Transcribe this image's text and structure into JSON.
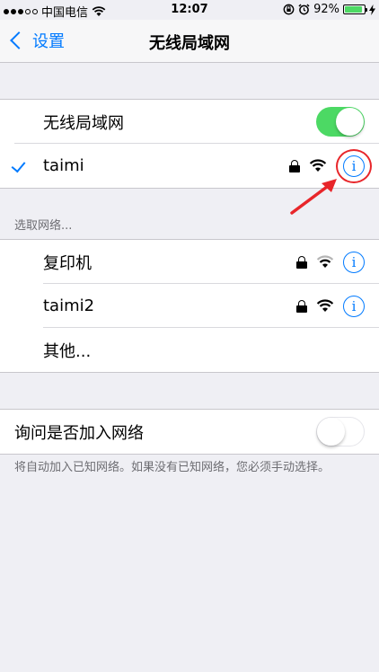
{
  "status_bar": {
    "signal_dots_filled": 3,
    "signal_dots_total": 5,
    "carrier": "中国电信",
    "time": "12:07",
    "battery_percent": "92%",
    "battery_level": 0.92,
    "icons": [
      "wifi-icon",
      "orientation-lock-icon",
      "alarm-icon",
      "charging-icon"
    ]
  },
  "nav": {
    "back_label": "设置",
    "title": "无线局域网"
  },
  "wifi_toggle": {
    "label": "无线局域网",
    "on": true
  },
  "connected_network": {
    "name": "taimi",
    "secured": true
  },
  "choose_network_header": "选取网络...",
  "networks": [
    {
      "name": "复印机",
      "secured": true
    },
    {
      "name": "taimi2",
      "secured": true
    }
  ],
  "other_label": "其他...",
  "ask_to_join": {
    "label": "询问是否加入网络",
    "on": false
  },
  "ask_to_join_note": "将自动加入已知网络。如果没有已知网络，您必须手动选择。",
  "colors": {
    "accent": "#007aff",
    "toggle_on": "#4cd964",
    "annotation": "#e8262a"
  }
}
